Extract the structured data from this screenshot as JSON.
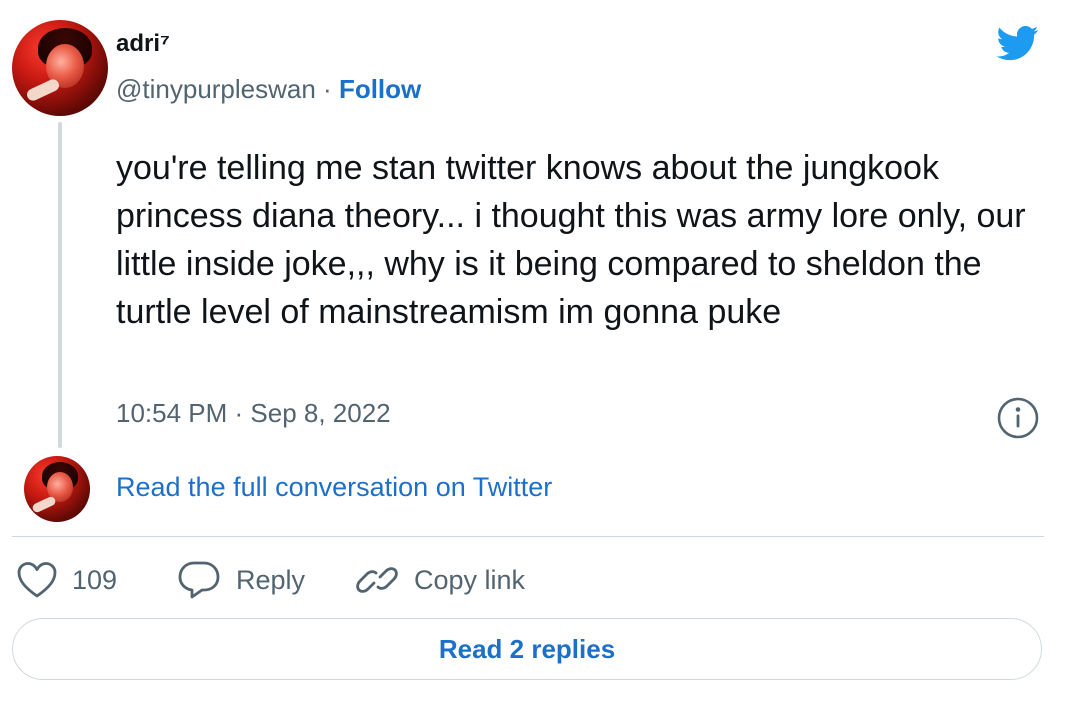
{
  "author": {
    "display_name": "adri⁷",
    "handle": "@tinypurpleswan",
    "separator": " · ",
    "follow_label": "Follow"
  },
  "tweet": {
    "text": "you're telling me stan twitter knows about the jungkook princess diana theory... i thought this was army lore only, our little inside joke,,, why is it being compared to sheldon the turtle level of mainstreamism im gonna puke",
    "timestamp": "10:54 PM · Sep 8, 2022"
  },
  "conversation": {
    "link_label": "Read the full conversation on Twitter"
  },
  "actions": {
    "like_count": "109",
    "reply_label": "Reply",
    "copy_label": "Copy link"
  },
  "replies_button": {
    "label": "Read 2 replies"
  },
  "colors": {
    "link_blue": "#1d70c9",
    "twitter_blue": "#1d9bf0",
    "secondary_text": "#536471",
    "border": "#cfd9de"
  },
  "icons": [
    "twitter-bird-icon",
    "info-icon",
    "heart-icon",
    "reply-bubble-icon",
    "link-icon"
  ]
}
